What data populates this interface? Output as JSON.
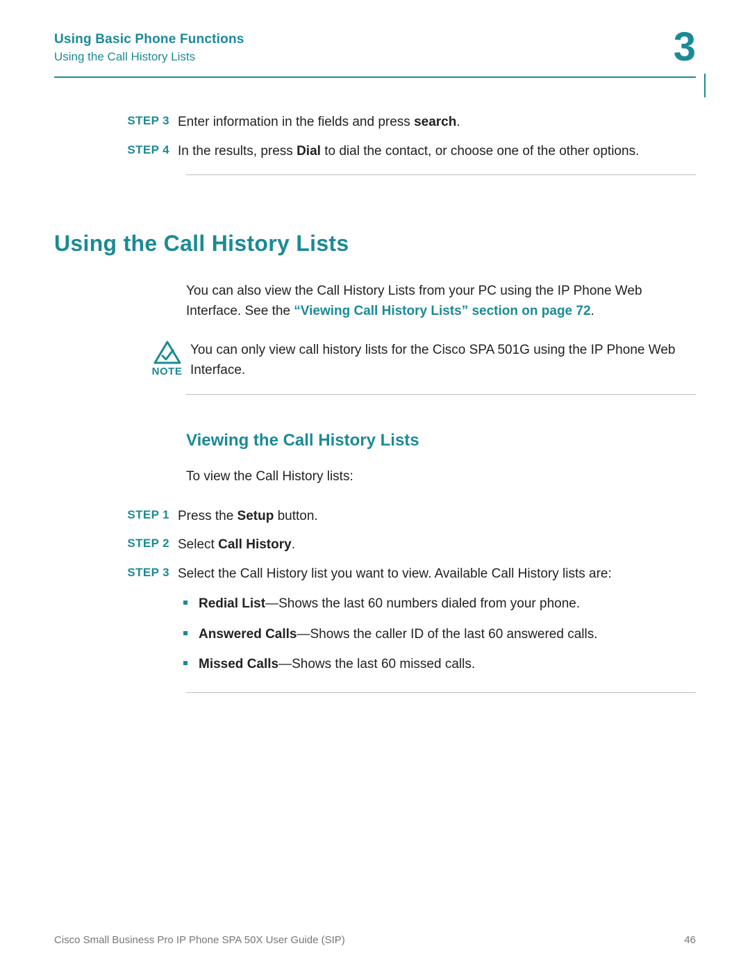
{
  "header": {
    "title": "Using Basic Phone Functions",
    "subtitle": "Using the Call History Lists",
    "chapter_number": "3"
  },
  "top_steps": {
    "step3": {
      "label": "STEP  3",
      "prefix": "Enter information in the fields and press ",
      "bold1": "search",
      "suffix": "."
    },
    "step4": {
      "label": "STEP  4",
      "prefix": "In the results, press ",
      "bold1": "Dial",
      "suffix": " to dial the contact, or choose one of the other options."
    }
  },
  "section1": {
    "heading": "Using the Call History Lists",
    "intro_prefix": "You can also view the Call History Lists from your PC using the IP Phone Web Interface. See the ",
    "intro_link": "“Viewing Call History Lists” section on page 72",
    "intro_suffix": "."
  },
  "note": {
    "label": "NOTE",
    "text": "You can only view call history lists for the Cisco SPA 501G using the IP Phone Web Interface."
  },
  "section2": {
    "heading": "Viewing the Call History Lists",
    "lead": "To view the Call History lists:",
    "step1": {
      "label": "STEP  1",
      "prefix": "Press the ",
      "bold1": "Setup",
      "suffix": " button."
    },
    "step2": {
      "label": "STEP  2",
      "prefix": "Select ",
      "bold1": "Call History",
      "suffix": "."
    },
    "step3": {
      "label": "STEP  3",
      "text": "Select the Call History list you want to view. Available Call History lists are:"
    },
    "bullets": {
      "b1": {
        "bold": "Redial List",
        "rest": "—Shows the last 60 numbers dialed from your phone."
      },
      "b2": {
        "bold": "Answered Calls",
        "rest": "—Shows the caller ID of the last 60 answered calls."
      },
      "b3": {
        "bold": "Missed Calls",
        "rest": "—Shows the last 60 missed calls."
      }
    }
  },
  "footer": {
    "left": "Cisco Small Business Pro IP Phone SPA 50X User Guide (SIP)",
    "right": "46"
  }
}
